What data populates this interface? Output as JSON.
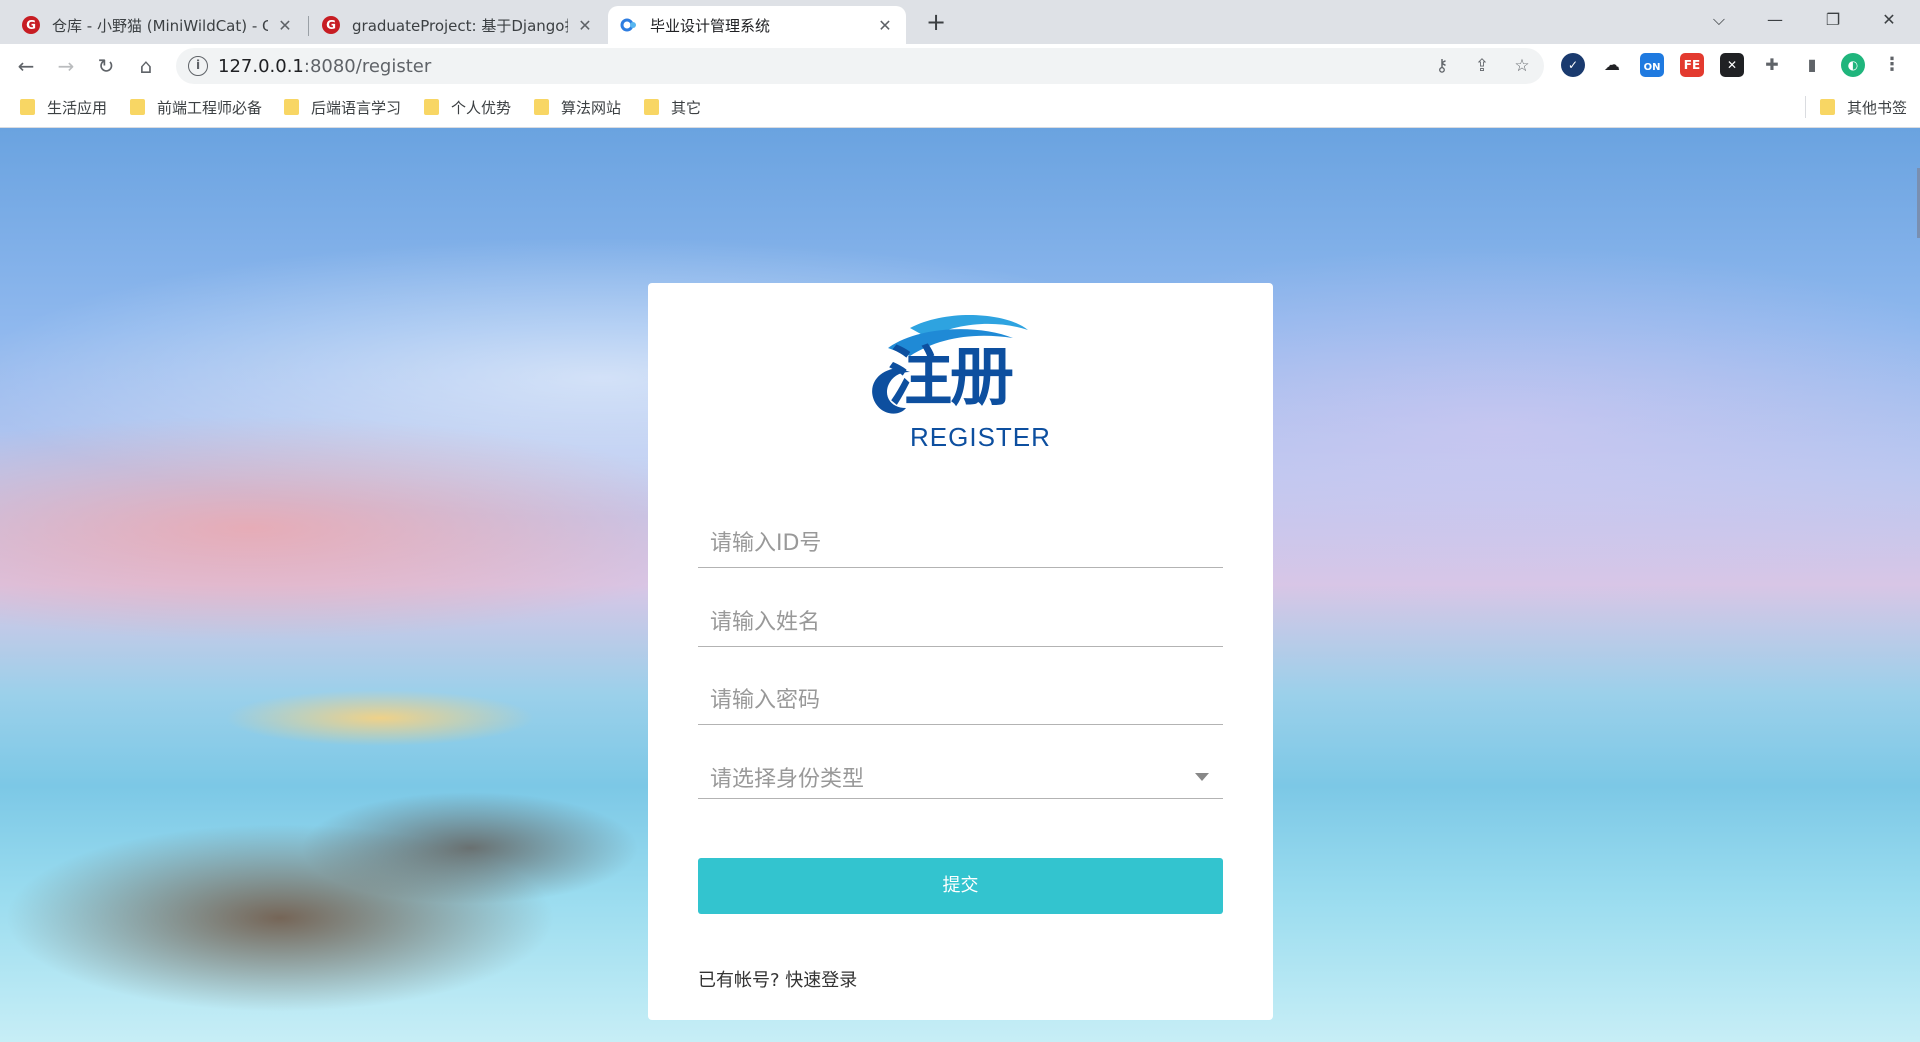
{
  "browser": {
    "tabs": [
      {
        "title": "仓库 - 小野猫 (MiniWildCat) - G",
        "favicon": "gitee-icon",
        "active": false
      },
      {
        "title": "graduateProject: 基于Django打",
        "favicon": "gitee-icon",
        "active": false
      },
      {
        "title": "毕业设计管理系统",
        "favicon": "site-icon",
        "active": true
      }
    ],
    "new_tab_symbol": "+",
    "url_host": "127.0.0.1",
    "url_path": ":8080/register",
    "bookmarks": [
      "生活应用",
      "前端工程师必备",
      "后端语言学习",
      "个人优势",
      "算法网站",
      "其它"
    ],
    "other_bookmarks": "其他书签",
    "extension_on_label": "ON",
    "extension_fe_label": "FE"
  },
  "page": {
    "logo_cn": "注册",
    "logo_en": "REGISTER",
    "form": {
      "id_placeholder": "请输入ID号",
      "name_placeholder": "请输入姓名",
      "password_placeholder": "请输入密码",
      "role_placeholder": "请选择身份类型",
      "submit_label": "提交",
      "has_account_text": "已有帐号?",
      "login_link": "快速登录"
    }
  },
  "colors": {
    "accent": "#33c4cf",
    "logo_blue": "#0d4f9f",
    "logo_wave": "#2ea3e0"
  }
}
